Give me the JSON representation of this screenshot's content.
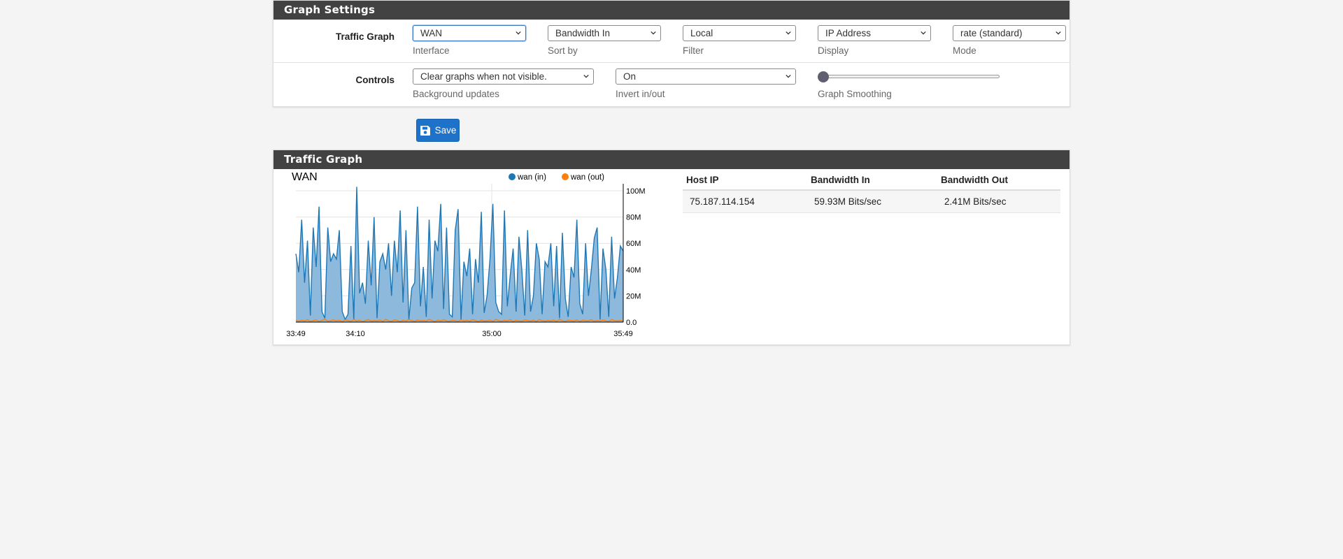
{
  "graph_settings": {
    "title": "Graph Settings",
    "traffic_graph_label": "Traffic Graph",
    "interface": {
      "value": "WAN",
      "help": "Interface"
    },
    "sort_by": {
      "value": "Bandwidth In",
      "help": "Sort by"
    },
    "filter": {
      "value": "Local",
      "help": "Filter"
    },
    "display": {
      "value": "IP Address",
      "help": "Display"
    },
    "mode": {
      "value": "rate (standard)",
      "help": "Mode"
    },
    "controls_label": "Controls",
    "background_updates": {
      "value": "Clear graphs when not visible.",
      "help": "Background updates"
    },
    "invert": {
      "value": "On",
      "help": "Invert in/out"
    },
    "smoothing": {
      "help": "Graph Smoothing",
      "value": 0
    }
  },
  "save_label": "Save",
  "traffic_graph": {
    "title": "Traffic Graph",
    "table": {
      "headers": [
        "Host IP",
        "Bandwidth In",
        "Bandwidth Out"
      ],
      "rows": [
        [
          "75.187.114.154",
          "59.93M Bits/sec",
          "2.41M Bits/sec"
        ]
      ]
    }
  },
  "chart_data": {
    "type": "area",
    "title": "WAN",
    "x_ticks": [
      "33:49",
      "34:10",
      "35:00",
      "35:49"
    ],
    "y_ticks": [
      "0.0",
      "20M",
      "40M",
      "60M",
      "80M",
      "100M"
    ],
    "ylim": [
      0,
      100
    ],
    "y_unit": "M",
    "x_range_seconds": [
      0,
      120
    ],
    "legend_position": "top-right",
    "grid": true,
    "series": [
      {
        "name": "wan (in)",
        "color": "#1f77b4",
        "values": [
          52,
          38,
          78,
          30,
          62,
          5,
          72,
          42,
          88,
          8,
          3,
          72,
          46,
          52,
          48,
          70,
          8,
          2,
          6,
          58,
          2,
          105,
          22,
          30,
          14,
          62,
          28,
          80,
          3,
          46,
          52,
          40,
          60,
          20,
          62,
          38,
          85,
          15,
          70,
          2,
          26,
          30,
          88,
          12,
          42,
          4,
          78,
          18,
          62,
          54,
          90,
          10,
          72,
          6,
          4,
          70,
          86,
          2,
          46,
          35,
          56,
          6,
          48,
          30,
          84,
          7,
          20,
          48,
          90,
          15,
          8,
          6,
          85,
          12,
          36,
          56,
          8,
          65,
          40,
          5,
          70,
          8,
          20,
          60,
          48,
          6,
          46,
          42,
          60,
          12,
          58,
          3,
          68,
          18,
          4,
          42,
          34,
          78,
          14,
          6,
          60,
          20,
          40,
          64,
          72,
          2,
          56,
          40,
          4,
          65,
          18,
          34,
          58,
          54
        ]
      },
      {
        "name": "wan (out)",
        "color": "#ff7f0e",
        "values": [
          1.2,
          0.6,
          1.5,
          0.8,
          1.9,
          0.4,
          1.1,
          1.7,
          0.5,
          1.3,
          2.2,
          0.7,
          1.0,
          1.6,
          0.9,
          1.4,
          0.3,
          1.8,
          1.2,
          0.6,
          2.0,
          0.8,
          1.5,
          0.4,
          1.1,
          1.9,
          0.7,
          1.3,
          0.9,
          1.6,
          0.5,
          2.1,
          1.0,
          0.6,
          1.7,
          1.2,
          0.4,
          1.4,
          0.8,
          1.9,
          1.1,
          0.5,
          1.6,
          0.9,
          1.3,
          0.7,
          2.0,
          1.2,
          0.4,
          1.5,
          0.8,
          1.8,
          1.0,
          0.6,
          1.4,
          1.1,
          0.5,
          1.7,
          0.9,
          1.3,
          0.7,
          1.9,
          1.2,
          0.4,
          1.6,
          0.8,
          1.0,
          1.5,
          0.6,
          2.1,
          1.1,
          0.7,
          1.3,
          0.9,
          1.8,
          0.5,
          1.4,
          1.0,
          0.6,
          1.7,
          1.2,
          0.8,
          1.5,
          0.4,
          1.9,
          1.1,
          0.7,
          1.3,
          0.9,
          1.6,
          0.5,
          2.0,
          1.0,
          0.6,
          1.4,
          1.2,
          0.8,
          1.7,
          0.4,
          1.5,
          0.9,
          1.1,
          1.8,
          0.6,
          1.3,
          0.7,
          1.6,
          1.0,
          0.5,
          1.9,
          1.2,
          0.8,
          1.4,
          0.6
        ]
      }
    ]
  }
}
